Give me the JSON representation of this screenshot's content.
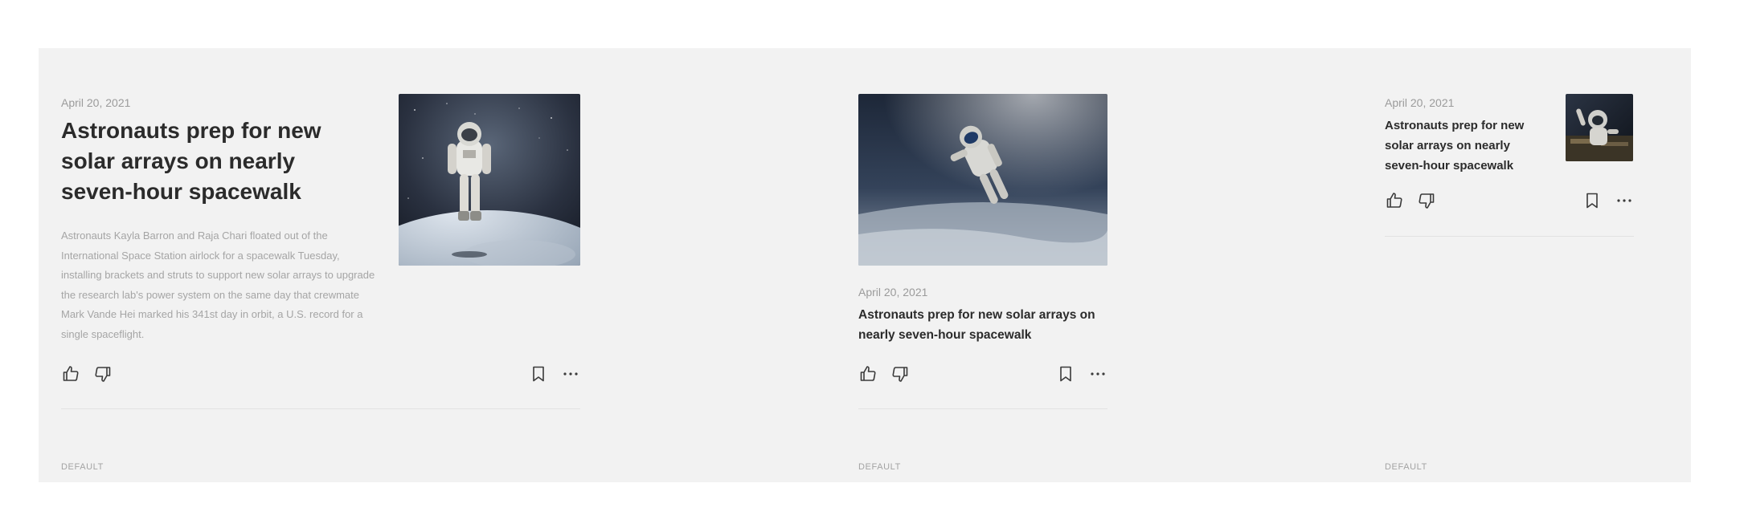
{
  "cards": [
    {
      "date": "April 20, 2021",
      "title": "Astronauts prep for new solar arrays on nearly seven-hour spacewalk",
      "excerpt": "Astronauts Kayla Barron and Raja Chari floated out of the International Space Station airlock for a spacewalk Tuesday, installing brackets and struts to support new solar arrays to upgrade the research lab's power system on the same day that crewmate Mark Vande Hei marked his 341st day in orbit, a U.S. record for a single spaceflight.",
      "variant": "DEFAULT"
    },
    {
      "date": "April 20, 2021",
      "title": "Astronauts prep for new solar arrays on nearly seven-hour spacewalk",
      "variant": "DEFAULT"
    },
    {
      "date": "April 20, 2021",
      "title": "Astronauts prep for new solar arrays on nearly seven-hour spacewalk",
      "variant": "DEFAULT"
    }
  ],
  "icons": {
    "like": "thumbs-up-icon",
    "dislike": "thumbs-down-icon",
    "bookmark": "bookmark-icon",
    "more": "more-horizontal-icon"
  },
  "colors": {
    "panel_background": "#f2f2f2",
    "title": "#2b2b2b",
    "meta": "#9b9b9b",
    "icon": "#3a3a3a"
  }
}
